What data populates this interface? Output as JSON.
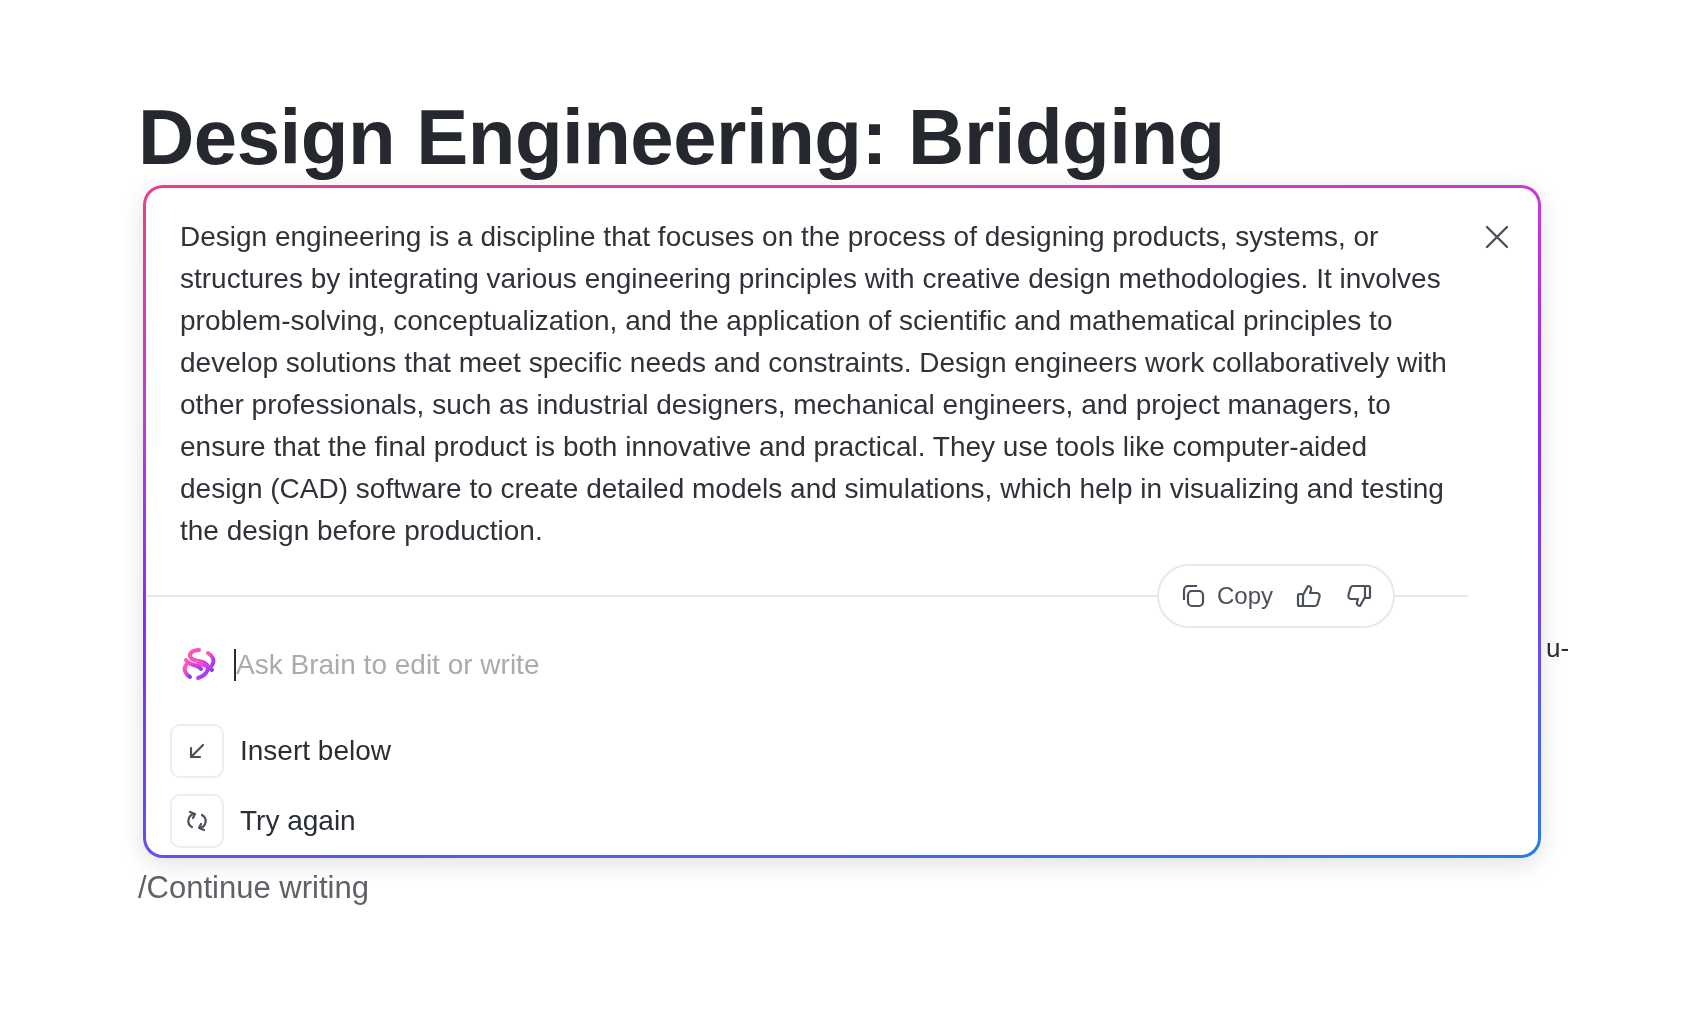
{
  "document": {
    "title": "Design Engineering: Bridging",
    "fragment": "u-",
    "continue_prompt": "/Continue writing"
  },
  "ai_panel": {
    "response": "Design engineering is a discipline that focuses on the process of designing products, systems, or structures by integrating various engineering principles with creative design methodologies. It involves problem-solving, conceptualization, and the application of scientific and mathematical principles to develop solutions that meet specific needs and constraints. Design engineers work collaboratively with other professionals, such as industrial designers, mechanical engineers, and project managers, to ensure that the final product is both innovative and practical. They use tools like computer-aided design (CAD) software to create detailed models and simulations, which help in visualizing and testing the design before production.",
    "toolbar": {
      "copy_label": "Copy"
    },
    "prompt": {
      "placeholder": "Ask Brain to edit or write"
    },
    "options": [
      {
        "kind": "insert",
        "label": "Insert below"
      },
      {
        "kind": "retry",
        "label": "Try again"
      }
    ]
  }
}
